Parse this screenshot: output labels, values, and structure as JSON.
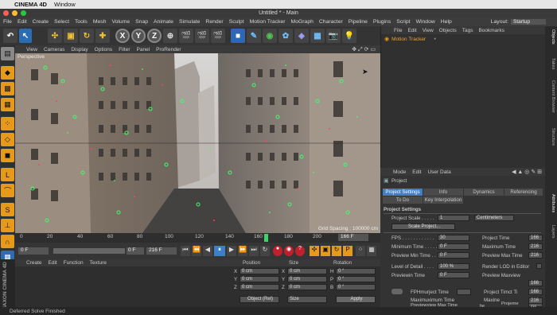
{
  "mac_menu": {
    "app": "CINEMA 4D",
    "window": "Window"
  },
  "title": "Untitled * - Main",
  "layout": {
    "label": "Layout:",
    "value": "Startup"
  },
  "menu": [
    "File",
    "Edit",
    "Create",
    "Select",
    "Tools",
    "Mesh",
    "Volume",
    "Snap",
    "Animate",
    "Simulate",
    "Render",
    "Sculpt",
    "Motion Tracker",
    "MoGraph",
    "Character",
    "Pipeline",
    "Plugins",
    "Script",
    "Window",
    "Help"
  ],
  "viewport_menu": [
    "View",
    "Cameras",
    "Display",
    "Options",
    "Filter",
    "Panel",
    "ProRender"
  ],
  "viewport": {
    "label": "Perspective",
    "grid_spacing": "Grid Spacing : 100000 cm"
  },
  "timeline": {
    "ticks": [
      "0",
      "20",
      "40",
      "60",
      "80",
      "100",
      "120",
      "140",
      "160",
      "180",
      "200"
    ],
    "current_frame": "166 F"
  },
  "transport": {
    "start": "0 F",
    "min": "0 F",
    "max": "216 F",
    "end": "216 F"
  },
  "material_menu": [
    "Create",
    "Edit",
    "Function",
    "Texture"
  ],
  "coords": {
    "headers": [
      "Position",
      "Size",
      "Rotation"
    ],
    "rows": [
      {
        "axis": "X",
        "pos": "0 cm",
        "saxis": "X",
        "size": "0 cm",
        "raxis": "H",
        "rot": "0 °"
      },
      {
        "axis": "Y",
        "pos": "0 cm",
        "saxis": "Y",
        "size": "0 cm",
        "raxis": "P",
        "rot": "0 °"
      },
      {
        "axis": "Z",
        "pos": "0 cm",
        "saxis": "Z",
        "size": "0 cm",
        "raxis": "B",
        "rot": "0 °"
      }
    ],
    "mode": "Object (Rel)",
    "size_mode": "Size",
    "apply": "Apply"
  },
  "status": "Deferred Solve Finished",
  "brand": "MAXON CINEMA 4D",
  "objects": {
    "menu": [
      "File",
      "Edit",
      "View",
      "Objects",
      "Tags",
      "Bookmarks"
    ],
    "items": [
      "Motion Tracker"
    ]
  },
  "attributes": {
    "menu": [
      "Mode",
      "Edit",
      "User Data"
    ],
    "title": "Project",
    "tabs": [
      "Project Settings",
      "Info",
      "Dynamics",
      "Referencing"
    ],
    "tabs2": [
      "To Do",
      "Key Interpolation"
    ],
    "section": "Project Settings",
    "scale_label": "Project Scale . . . . .",
    "scale_value": "1",
    "scale_unit": "Centimeters",
    "scale_button": "Scale Project...",
    "left_rows": [
      {
        "label": "FPS . . . . . . . . . . . .",
        "value": "30"
      },
      {
        "label": "Minimum Time . . . . .",
        "value": "0 F"
      },
      {
        "label": "Preview Min Time . .",
        "value": "0 F"
      },
      {
        "label": "Level of Detail . . . .",
        "value": "100 %"
      },
      {
        "label": "Previewin Time",
        "value": "0 F"
      }
    ],
    "right_rows": [
      {
        "label": "Project Time",
        "value": "166"
      },
      {
        "label": "Maximum Time",
        "value": "216"
      },
      {
        "label": "Preview Max Time",
        "value": "216"
      },
      {
        "label": "Render LOD in Editor",
        "value": ""
      },
      {
        "label": "Preview Maxview",
        "value": "166"
      }
    ],
    "garbled": [
      "FPHmurject Time",
      "Maximuximum Time",
      "Previewview Max Time",
      "Project Timct Ti",
      "Maxine",
      "Projeme",
      "he"
    ],
    "extra_values": [
      "166",
      "216",
      "216"
    ]
  },
  "right_tabs": [
    "Objects",
    "Takes",
    "Content Browser",
    "Structure",
    "Attributes",
    "Layers"
  ],
  "colors": {
    "accent": "#3d7fc9",
    "mocap_orange": "#e79a1a",
    "tracker_green": "#3cff6a",
    "tracker_red": "#ff4060"
  }
}
